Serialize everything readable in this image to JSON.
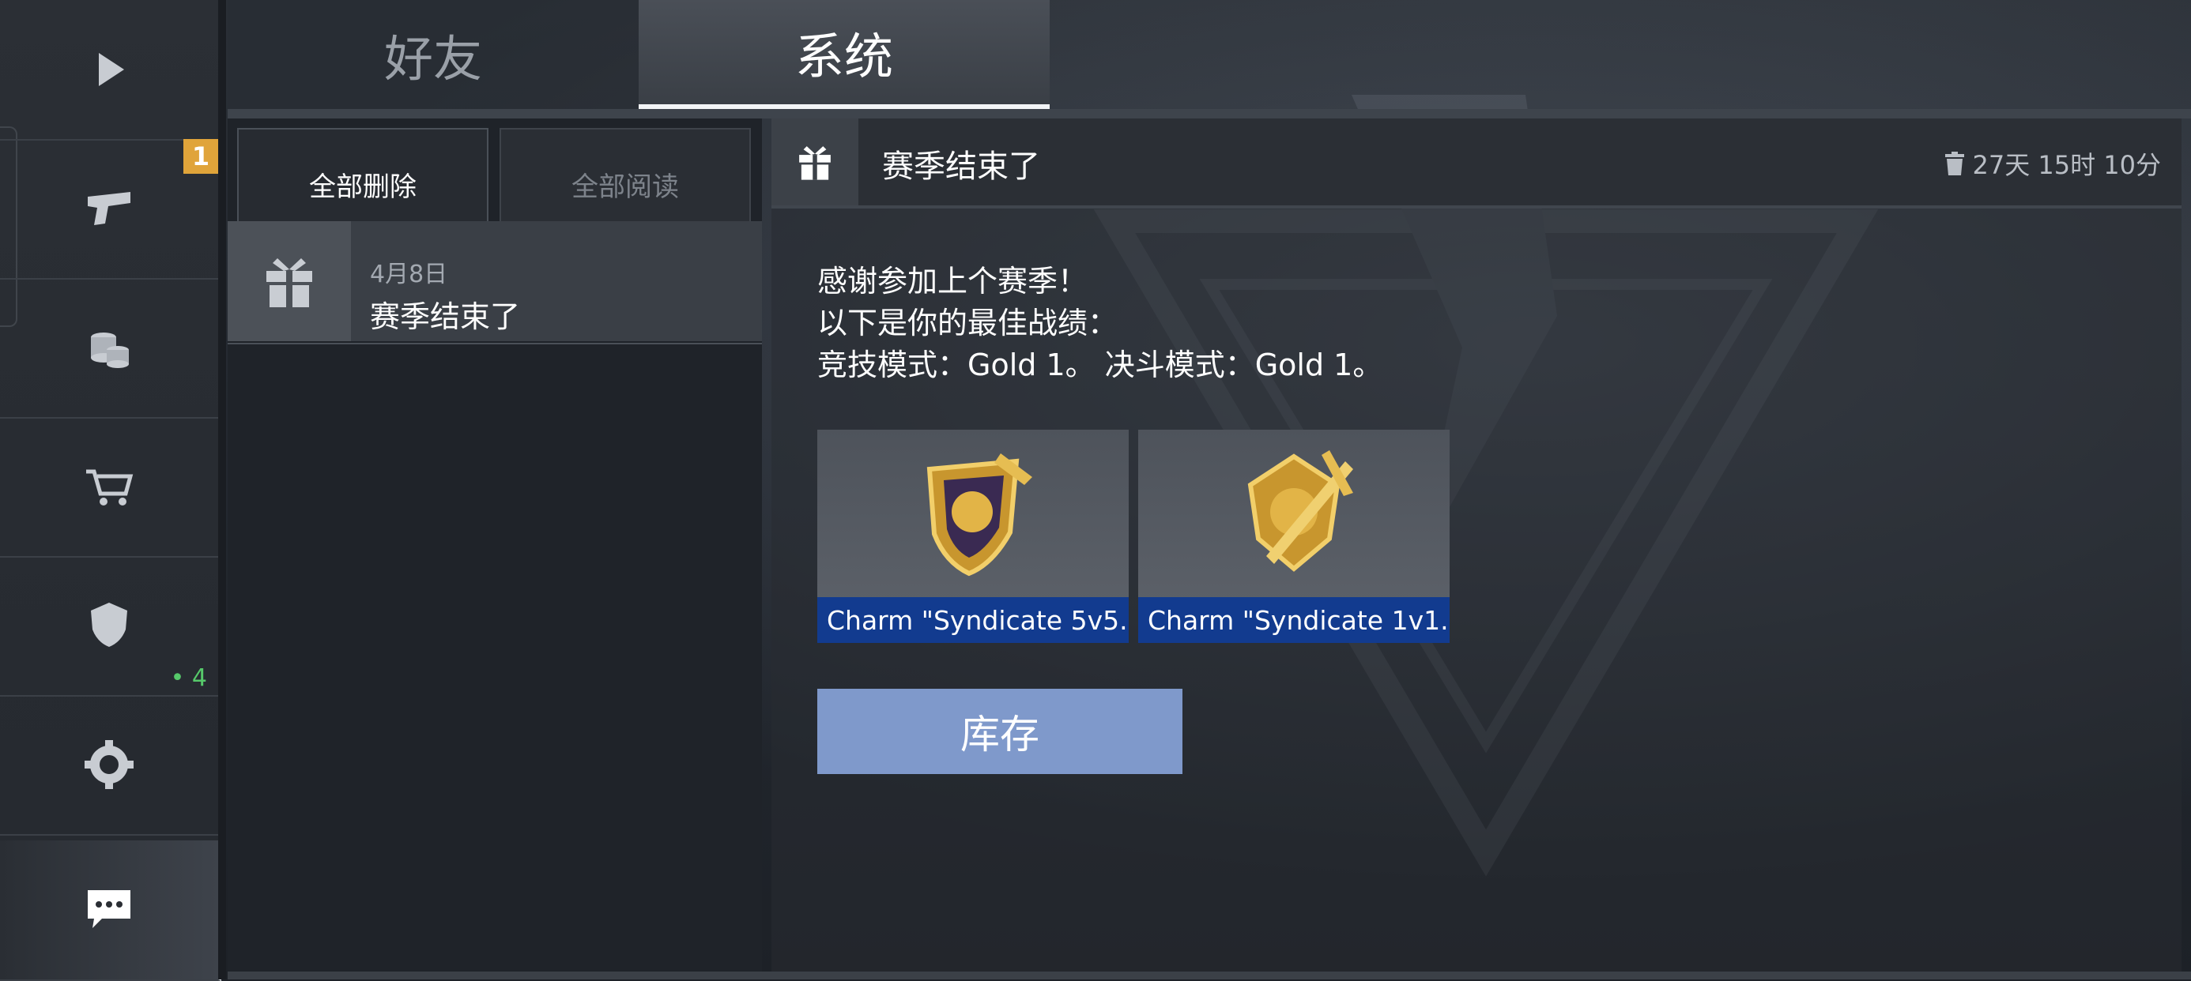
{
  "nav": {
    "items": [
      {
        "icon": "play-icon"
      },
      {
        "icon": "pistol-icon",
        "badge": "1"
      },
      {
        "icon": "coins-icon"
      },
      {
        "icon": "cart-icon"
      },
      {
        "icon": "rank-shield-icon",
        "count": "• 4"
      },
      {
        "icon": "gear-icon"
      },
      {
        "icon": "chat-icon",
        "active": true
      }
    ]
  },
  "tabs": [
    {
      "label": "好友"
    },
    {
      "label": "系统",
      "selected": true
    }
  ],
  "list": {
    "delete_all": "全部删除",
    "read_all": "全部阅读",
    "items": [
      {
        "date": "4月8日",
        "title": "赛季结束了",
        "icon": "gift-icon"
      }
    ]
  },
  "detail": {
    "title": "赛季结束了",
    "expire": "27天 15时 10分",
    "lines": [
      "感谢参加上个赛季！",
      "以下是你的最佳战绩：",
      "竞技模式：Gold 1。 决斗模式：Gold 1。"
    ],
    "rewards": [
      {
        "label": "Charm \"Syndicate 5v5..."
      },
      {
        "label": "Charm \"Syndicate 1v1..."
      }
    ],
    "inventory_button": "库存"
  },
  "colors": {
    "badge": "#e0a43a",
    "reward_label": "#123b8f",
    "inventory_button": "#7f99cb",
    "count_green": "#56c96a"
  }
}
